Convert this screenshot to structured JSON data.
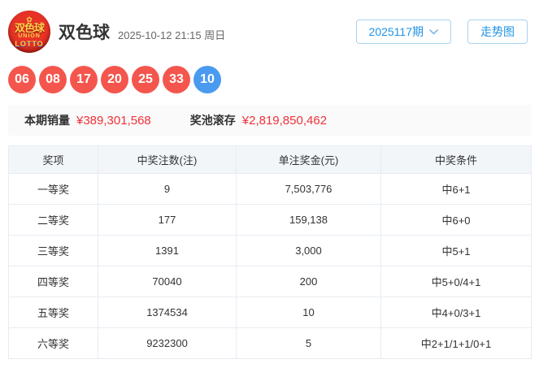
{
  "header": {
    "logo": {
      "flower": "✿",
      "line1": "双色球",
      "line2": "UNION",
      "line3": "LOTTO"
    },
    "title": "双色球",
    "datetime": "2025-10-12 21:15 周日",
    "period_button": "2025117期",
    "trend_button": "走势图"
  },
  "balls": {
    "red": [
      "06",
      "08",
      "17",
      "20",
      "25",
      "33"
    ],
    "blue": [
      "10"
    ]
  },
  "stats": {
    "sales_label": "本期销量",
    "sales_value": "¥389,301,568",
    "jackpot_label": "奖池滚存",
    "jackpot_value": "¥2,819,850,462"
  },
  "table": {
    "headers": [
      "奖项",
      "中奖注数(注)",
      "单注奖金(元)",
      "中奖条件"
    ],
    "rows": [
      [
        "一等奖",
        "9",
        "7,503,776",
        "中6+1"
      ],
      [
        "二等奖",
        "177",
        "159,138",
        "中6+0"
      ],
      [
        "三等奖",
        "1391",
        "3,000",
        "中5+1"
      ],
      [
        "四等奖",
        "70040",
        "200",
        "中5+0/4+1"
      ],
      [
        "五等奖",
        "1374534",
        "10",
        "中4+0/3+1"
      ],
      [
        "六等奖",
        "9232300",
        "5",
        "中2+1/1+1/0+1"
      ]
    ]
  },
  "colors": {
    "accent_blue": "#2193e6",
    "button_border": "#a9d2f0",
    "ball_red": "#f4564d",
    "ball_blue": "#4a9af0",
    "value_red": "#f03038",
    "table_header_bg": "#f3f6f9",
    "table_border": "#e7ecf2",
    "stats_bg": "#fafafa"
  }
}
